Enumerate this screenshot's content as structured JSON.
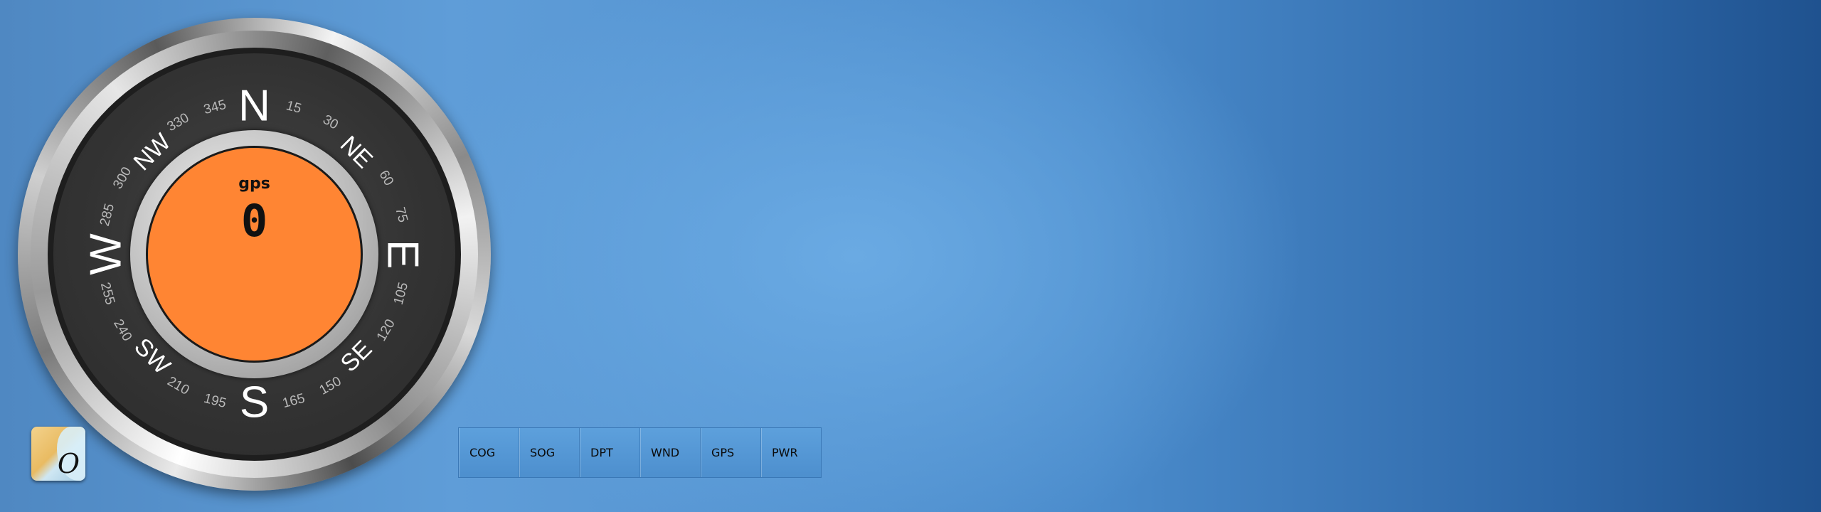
{
  "compass": {
    "cardinals": {
      "n": "N",
      "ne": "NE",
      "e": "E",
      "se": "SE",
      "s": "S",
      "sw": "SW",
      "w": "W",
      "nw": "NW"
    },
    "degrees": {
      "d15": "15",
      "d30": "30",
      "d60": "60",
      "d75": "75",
      "d105": "105",
      "d120": "120",
      "d150": "150",
      "d165": "165",
      "d195": "195",
      "d210": "210",
      "d240": "240",
      "d255": "255",
      "d285": "285",
      "d300": "300",
      "d330": "330",
      "d345": "345"
    },
    "center_label": "gps",
    "center_value": "0",
    "face_color": "#ff8533"
  },
  "app_icon": {
    "glyph": "O",
    "icon": "app-launcher-icon"
  },
  "toolbar": {
    "buttons": [
      {
        "label": "COG"
      },
      {
        "label": "SOG"
      },
      {
        "label": "DPT"
      },
      {
        "label": "WND"
      },
      {
        "label": "GPS"
      },
      {
        "label": "PWR"
      }
    ]
  },
  "colors": {
    "background": "#5f9dd8",
    "toolbar": "#5da0dc",
    "dial": "#333333"
  }
}
